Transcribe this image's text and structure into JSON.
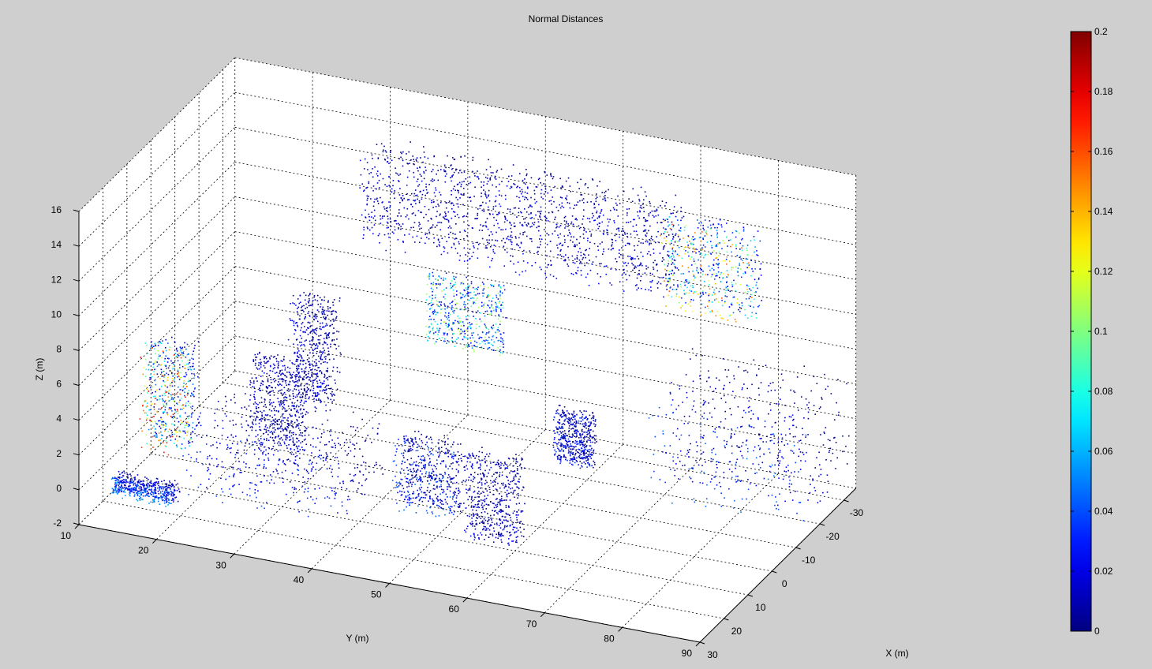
{
  "chart_data": {
    "type": "scatter",
    "title": "Normal Distances",
    "xlabel": "X (m)",
    "ylabel": "Y (m)",
    "zlabel": "Z (m)",
    "xlim": [
      -35,
      30
    ],
    "ylim": [
      10,
      90
    ],
    "zlim": [
      -2,
      16
    ],
    "x_ticks": [
      -30,
      -20,
      -10,
      0,
      10,
      20,
      30
    ],
    "y_ticks": [
      10,
      20,
      30,
      40,
      50,
      60,
      70,
      80,
      90
    ],
    "z_ticks": [
      -2,
      0,
      2,
      4,
      6,
      8,
      10,
      12,
      14,
      16
    ],
    "grid": true,
    "colormap": "jet",
    "colorbar": {
      "range": [
        0,
        0.2
      ],
      "ticks": [
        0,
        0.02,
        0.04,
        0.06,
        0.08,
        0.1,
        0.12,
        0.14,
        0.16,
        0.18,
        0.2
      ]
    },
    "series": [
      {
        "x_range": [
          -30,
          -20
        ],
        "y_range": [
          30,
          70
        ],
        "z_range": [
          9,
          14
        ],
        "c_range": [
          0.0,
          0.03
        ]
      },
      {
        "x_range": [
          -29,
          -24
        ],
        "y_range": [
          68,
          80
        ],
        "z_range": [
          8,
          13
        ],
        "c_range": [
          0.02,
          0.16
        ]
      },
      {
        "x_range": [
          -35,
          -33
        ],
        "y_range": [
          35,
          45
        ],
        "z_range": [
          2,
          6
        ],
        "c_range": [
          0.02,
          0.12
        ]
      },
      {
        "x_range": [
          12,
          18
        ],
        "y_range": [
          14,
          20
        ],
        "z_range": [
          1,
          7
        ],
        "c_range": [
          0.01,
          0.18
        ]
      },
      {
        "x_range": [
          5,
          8
        ],
        "y_range": [
          25,
          32
        ],
        "z_range": [
          1,
          6
        ],
        "c_range": [
          0.0,
          0.03
        ]
      },
      {
        "x_range": [
          -15,
          -8
        ],
        "y_range": [
          25,
          30
        ],
        "z_range": [
          1,
          7
        ],
        "c_range": [
          0.0,
          0.03
        ]
      },
      {
        "x_range": [
          0,
          20
        ],
        "y_range": [
          20,
          40
        ],
        "z_range": [
          -1,
          3
        ],
        "c_range": [
          0.0,
          0.04
        ]
      },
      {
        "x_range": [
          20,
          24
        ],
        "y_range": [
          12,
          20
        ],
        "z_range": [
          -1,
          0
        ],
        "c_range": [
          0.01,
          0.06
        ]
      },
      {
        "x_range": [
          4,
          10
        ],
        "y_range": [
          44,
          52
        ],
        "z_range": [
          -1,
          3
        ],
        "c_range": [
          0.0,
          0.05
        ]
      },
      {
        "x_range": [
          12,
          16
        ],
        "y_range": [
          55,
          62
        ],
        "z_range": [
          -1,
          4
        ],
        "c_range": [
          0.0,
          0.03
        ]
      },
      {
        "x_range": [
          -8,
          -5
        ],
        "y_range": [
          60,
          65
        ],
        "z_range": [
          1,
          4
        ],
        "c_range": [
          0.0,
          0.04
        ]
      },
      {
        "x_range": [
          -34,
          -10
        ],
        "y_range": [
          70,
          90
        ],
        "z_range": [
          -1,
          5
        ],
        "c_range": [
          0.0,
          0.05
        ]
      }
    ]
  }
}
